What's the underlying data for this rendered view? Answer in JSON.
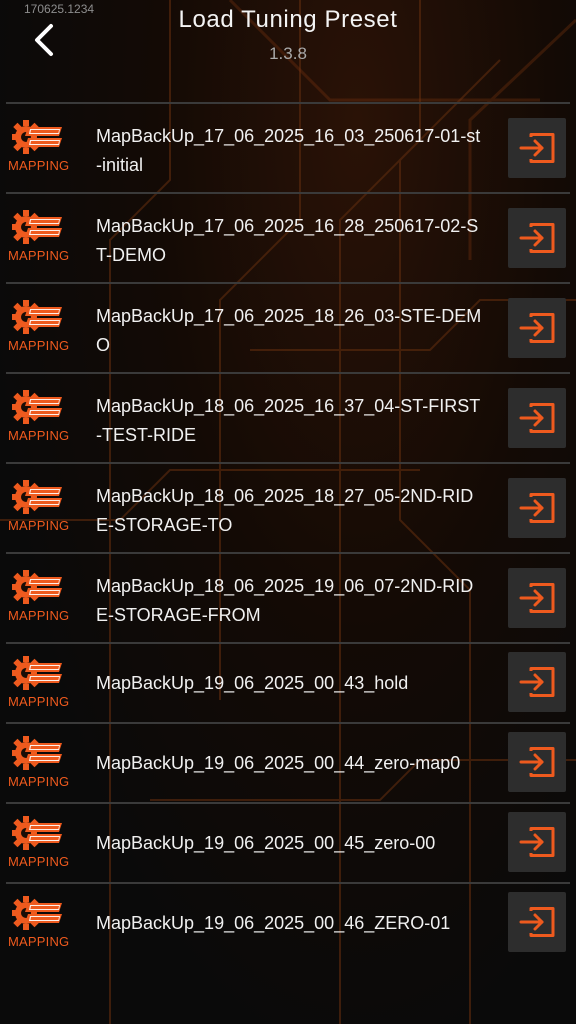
{
  "header": {
    "build_tag": "170625.1234",
    "title": "Load Tuning Preset",
    "version": "1.3.8"
  },
  "colors": {
    "accent": "#ee5a1e",
    "button_bg": "#2d2d2d",
    "divider": "#3a3a3a"
  },
  "icons": {
    "back": "chevron-left-icon",
    "logo": "tuneboss-gear-logo",
    "load": "sign-in-arrow-icon"
  },
  "presets": [
    {
      "brand_label": "MAPPING",
      "name": "MapBackUp_17_06_2025_16_03_250617-01-st-initial"
    },
    {
      "brand_label": "MAPPING",
      "name": "MapBackUp_17_06_2025_16_28_250617-02-ST-DEMO"
    },
    {
      "brand_label": "MAPPING",
      "name": "MapBackUp_17_06_2025_18_26_03-STE-DEMO"
    },
    {
      "brand_label": "MAPPING",
      "name": "MapBackUp_18_06_2025_16_37_04-ST-FIRST-TEST-RIDE"
    },
    {
      "brand_label": "MAPPING",
      "name": "MapBackUp_18_06_2025_18_27_05-2ND-RIDE-STORAGE-TO"
    },
    {
      "brand_label": "MAPPING",
      "name": "MapBackUp_18_06_2025_19_06_07-2ND-RIDE-STORAGE-FROM"
    },
    {
      "brand_label": "MAPPING",
      "name": "MapBackUp_19_06_2025_00_43_hold"
    },
    {
      "brand_label": "MAPPING",
      "name": "MapBackUp_19_06_2025_00_44_zero-map0"
    },
    {
      "brand_label": "MAPPING",
      "name": "MapBackUp_19_06_2025_00_45_zero-00"
    },
    {
      "brand_label": "MAPPING",
      "name": "MapBackUp_19_06_2025_00_46_ZERO-01"
    }
  ]
}
